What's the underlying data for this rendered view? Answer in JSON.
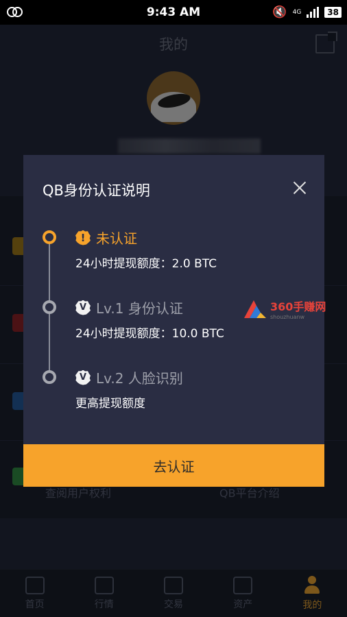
{
  "status_bar": {
    "time": "9:43 AM",
    "battery": "38",
    "network": "4G"
  },
  "header": {
    "title": "我的"
  },
  "background": {
    "row_labels": [
      "查阅用户权利",
      "QB平台介绍"
    ]
  },
  "modal": {
    "title": "QB身份认证说明",
    "steps": [
      {
        "title": "未认证",
        "desc": "24小时提现额度：2.0 BTC",
        "badge": "!"
      },
      {
        "title": "Lv.1 身份认证",
        "desc": "24小时提现额度：10.0 BTC",
        "badge": "V"
      },
      {
        "title": "Lv.2 人脸识别",
        "desc": "更高提现额度",
        "badge": "V"
      }
    ],
    "confirm_label": "去认证"
  },
  "watermark": {
    "text": "360手赚网",
    "sub": "shouzhuanw"
  },
  "bottom_nav": {
    "items": [
      {
        "label": "首页",
        "icon": "home-icon"
      },
      {
        "label": "行情",
        "icon": "chart-icon"
      },
      {
        "label": "交易",
        "icon": "bitcoin-icon"
      },
      {
        "label": "资产",
        "icon": "wallet-icon"
      },
      {
        "label": "我的",
        "icon": "user-icon"
      }
    ]
  },
  "colors": {
    "accent": "#f7a32b",
    "modal_bg": "#2a2d43",
    "page_bg": "#1e2233"
  }
}
